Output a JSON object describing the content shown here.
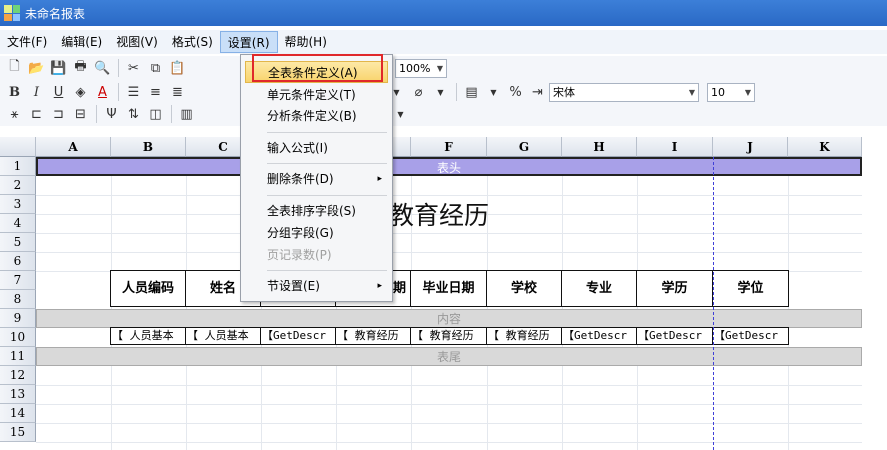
{
  "window": {
    "title": "未命名报表"
  },
  "menubar": {
    "items": [
      "文件(F)",
      "编辑(E)",
      "视图(V)",
      "格式(S)",
      "设置(R)",
      "帮助(H)"
    ]
  },
  "toolbar": {
    "zoom": "100%",
    "font": "宋体",
    "font_size": "10",
    "percent_symbol": "%"
  },
  "sheet": {
    "columns": [
      "A",
      "B",
      "C",
      "D",
      "E",
      "F",
      "G",
      "H",
      "I",
      "J",
      "K"
    ],
    "rows": [
      "1",
      "2",
      "3",
      "4",
      "5",
      "6",
      "7",
      "8",
      "9",
      "10",
      "11",
      "12",
      "13",
      "14",
      "15"
    ],
    "band_header": "表头",
    "band_content": "内容",
    "band_footer": "表尾",
    "title": "教育经历",
    "headers": [
      "人员编码",
      "姓名",
      "",
      "业日期",
      "毕业日期",
      "学校",
      "专业",
      "学历",
      "学位"
    ],
    "data_cells": [
      "【 人员基本",
      "【 人员基本",
      "【GetDescr",
      "【 教育经历",
      "【 教育经历",
      "【 教育经历",
      "【GetDescr",
      "【GetDescr",
      "【GetDescr"
    ]
  },
  "dropdown": {
    "items": [
      {
        "label": "全表条件定义(A)",
        "highlighted": true
      },
      {
        "label": "单元条件定义(T)"
      },
      {
        "label": "分析条件定义(B)"
      },
      {
        "label": "输入公式(I)"
      },
      {
        "label": "删除条件(D)",
        "submenu": "▸"
      },
      {
        "label": "全表排序字段(S)"
      },
      {
        "label": "分组字段(G)"
      },
      {
        "label": "页记录数(P)",
        "disabled": true
      },
      {
        "label": "节设置(E)",
        "submenu": "▸"
      }
    ]
  }
}
